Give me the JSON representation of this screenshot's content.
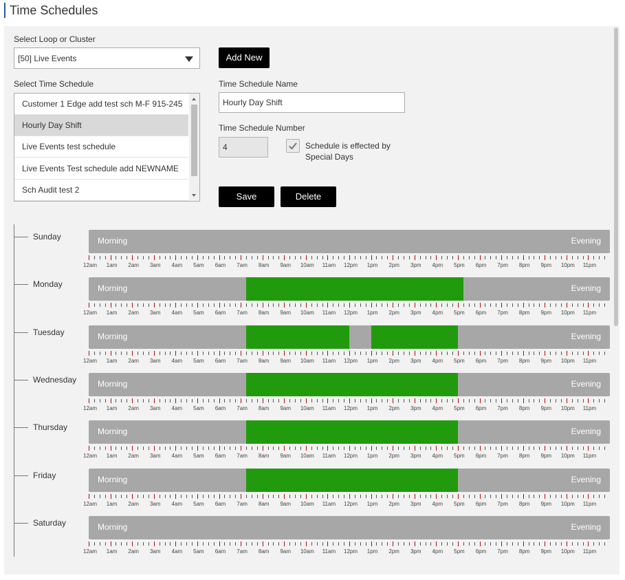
{
  "page": {
    "title": "Time Schedules"
  },
  "form": {
    "loop_label": "Select Loop or Cluster",
    "loop_value": "[50] Live Events",
    "add_new_label": "Add New",
    "schedule_list_label": "Select Time Schedule",
    "schedules": [
      {
        "label": "Customer 1 Edge add test sch M-F 915-245",
        "selected": false
      },
      {
        "label": "Hourly Day Shift",
        "selected": true
      },
      {
        "label": "Live Events test schedule",
        "selected": false
      },
      {
        "label": "Live Events Test schedule add NEWNAME",
        "selected": false
      },
      {
        "label": "Sch Audit test 2",
        "selected": false
      }
    ],
    "name_label": "Time Schedule Name",
    "name_value": "Hourly Day Shift",
    "number_label": "Time Schedule Number",
    "number_value": "4",
    "special_days_checked": true,
    "special_days_label_line1": "Schedule is effected by",
    "special_days_label_line2": "Special Days",
    "save_label": "Save",
    "delete_label": "Delete"
  },
  "timeline": {
    "morning_label": "Morning",
    "evening_label": "Evening",
    "hour_labels": [
      "12am",
      "1am",
      "2am",
      "3am",
      "4am",
      "5am",
      "6am",
      "7am",
      "8am",
      "9am",
      "10am",
      "11am",
      "12pm",
      "1pm",
      "2pm",
      "3pm",
      "4pm",
      "5pm",
      "6pm",
      "7pm",
      "8pm",
      "9pm",
      "10pm",
      "11pm"
    ],
    "days": [
      {
        "name": "Sunday",
        "blocks": []
      },
      {
        "name": "Monday",
        "blocks": [
          {
            "start": "7:15am",
            "end": "5:15pm"
          }
        ]
      },
      {
        "name": "Tuesday",
        "blocks": [
          {
            "start": "7:15am",
            "end": "12pm"
          },
          {
            "start": "1pm",
            "end": "5pm"
          }
        ]
      },
      {
        "name": "Wednesday",
        "blocks": [
          {
            "start": "7:15am",
            "end": "5pm"
          }
        ]
      },
      {
        "name": "Thursday",
        "blocks": [
          {
            "start": "7:15am",
            "end": "5pm"
          }
        ]
      },
      {
        "name": "Friday",
        "blocks": [
          {
            "start": "7:15am",
            "end": "5pm"
          }
        ]
      },
      {
        "name": "Saturday",
        "blocks": []
      }
    ]
  },
  "colors": {
    "accent": "#1f57a8",
    "active_block": "#219a0e",
    "inactive_bar": "#a7a7a7",
    "hour_tick": "#c00000",
    "quarter_tick": "#555555"
  }
}
